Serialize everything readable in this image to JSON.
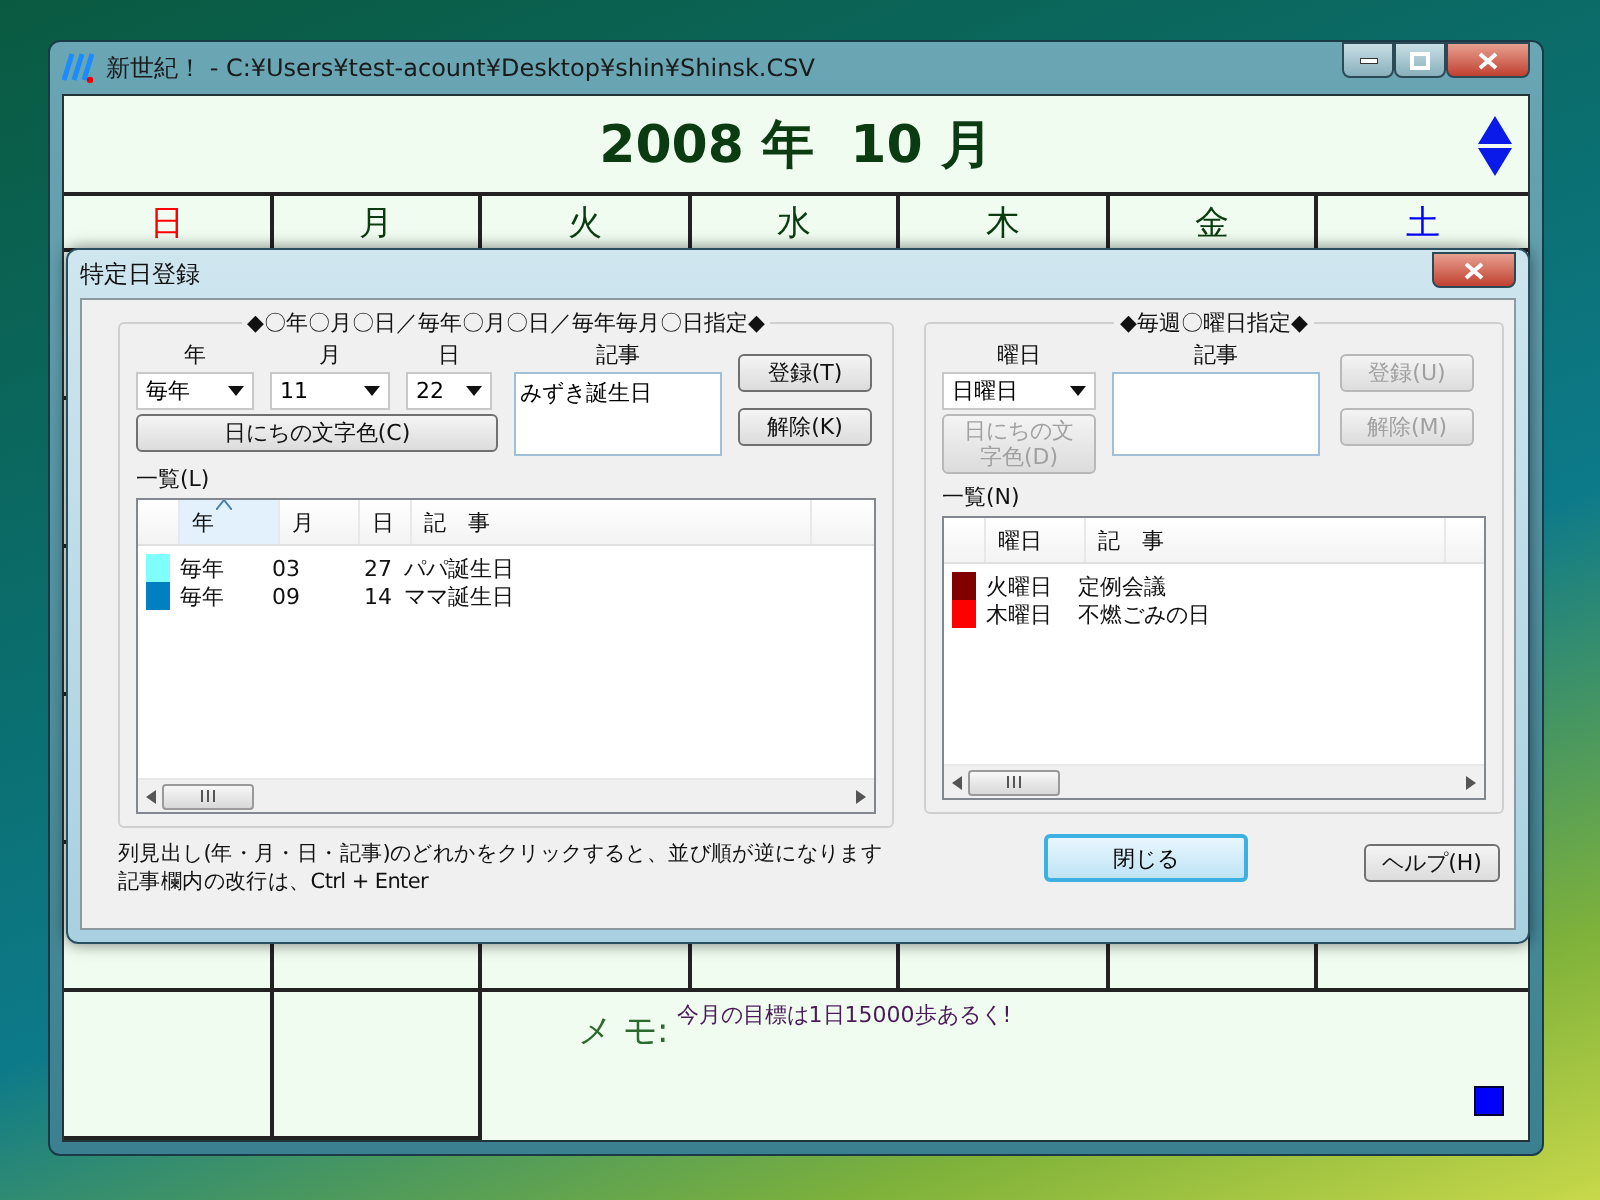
{
  "window": {
    "title": "新世紀！ - C:¥Users¥test-acount¥Desktop¥shin¥Shinsk.CSV"
  },
  "calendar": {
    "year": "2008",
    "year_unit": "年",
    "month": "10",
    "month_unit": "月",
    "weekdays": [
      {
        "label": "日",
        "kind": "sunday"
      },
      {
        "label": "月",
        "kind": "weekday"
      },
      {
        "label": "火",
        "kind": "weekday"
      },
      {
        "label": "水",
        "kind": "weekday"
      },
      {
        "label": "木",
        "kind": "weekday"
      },
      {
        "label": "金",
        "kind": "weekday"
      },
      {
        "label": "土",
        "kind": "saturday"
      }
    ],
    "memo_label": "メ モ:",
    "memo": "今月の目標は1日15000歩あるく!"
  },
  "dialog": {
    "title": "特定日登録",
    "date_group": {
      "title": "◆〇年〇月〇日／毎年〇月〇日／毎年毎月〇日指定◆",
      "year_label": "年",
      "year": "毎年",
      "month_label": "月",
      "month": "11",
      "day_label": "日",
      "day": "22",
      "memo_label": "記事",
      "memo": "みずき誕生日",
      "color_button": {
        "label": "日にちの文字色(C)",
        "disabled": false
      },
      "register_button": {
        "label": "登録(T)",
        "disabled": false
      },
      "delete_button": {
        "label": "解除(K)",
        "disabled": false
      },
      "list_label": "一覧(L)",
      "columns": [
        {
          "label": "年",
          "sorted": true
        },
        {
          "label": "月",
          "sorted": false
        },
        {
          "label": "日",
          "sorted": false
        },
        {
          "label": "記　事",
          "sorted": false
        }
      ],
      "rows": [
        {
          "color": "#80ffff",
          "cells": [
            "毎年",
            "03",
            "27",
            "パパ誕生日"
          ]
        },
        {
          "color": "#0080c0",
          "cells": [
            "毎年",
            "09",
            "14",
            "ママ誕生日"
          ]
        }
      ]
    },
    "weekly_group": {
      "title": "◆毎週〇曜日指定◆",
      "weekday_label": "曜日",
      "weekday": "日曜日",
      "memo_label": "記事",
      "color_button": {
        "label": "日にちの文字色(D)",
        "disabled": true
      },
      "register_button": {
        "label": "登録(U)",
        "disabled": true
      },
      "delete_button": {
        "label": "解除(M)",
        "disabled": true
      },
      "list_label": "一覧(N)",
      "columns": [
        {
          "label": "曜日",
          "sorted": false
        },
        {
          "label": "記　事",
          "sorted": false
        }
      ],
      "rows": [
        {
          "color": "#800000",
          "cells": [
            "火曜日",
            "定例会議"
          ]
        },
        {
          "color": "#ff0000",
          "cells": [
            "木曜日",
            "不燃ごみの日"
          ]
        }
      ]
    },
    "hints": [
      "列見出し(年・月・日・記事)のどれかをクリックすると、並び順が逆になります",
      "記事欄内の改行は、Ctrl + Enter"
    ],
    "close_button": "閉じる",
    "help_button": "ヘルプ(H)"
  }
}
